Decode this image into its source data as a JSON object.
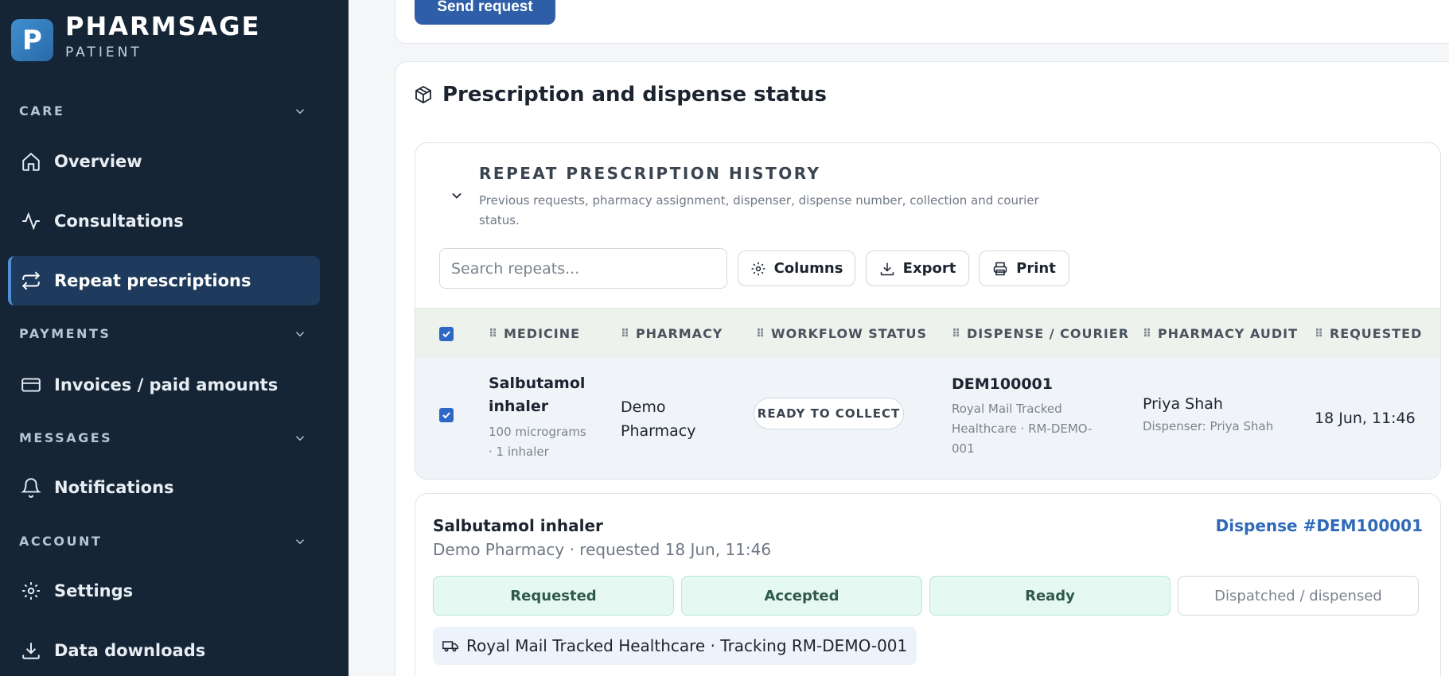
{
  "brand": {
    "logo_letter": "P",
    "name": "PHARMSAGE",
    "subtitle": "PATIENT"
  },
  "sidebar": {
    "sections": [
      {
        "label": "CARE"
      },
      {
        "label": "PAYMENTS"
      },
      {
        "label": "MESSAGES"
      },
      {
        "label": "ACCOUNT"
      }
    ],
    "items": [
      {
        "label": "Overview",
        "icon": "home-icon"
      },
      {
        "label": "Consultations",
        "icon": "activity-icon"
      },
      {
        "label": "Repeat prescriptions",
        "icon": "repeat-icon",
        "active": true
      },
      {
        "label": "Invoices / paid amounts",
        "icon": "credit-card-icon"
      },
      {
        "label": "Notifications",
        "icon": "bell-icon"
      },
      {
        "label": "Settings",
        "icon": "gear-icon"
      },
      {
        "label": "Data downloads",
        "icon": "download-icon"
      }
    ]
  },
  "top": {
    "send_label": "Send request"
  },
  "status": {
    "title": "Prescription and dispense status",
    "history": {
      "title": "REPEAT PRESCRIPTION HISTORY",
      "description": "Previous requests, pharmacy assignment, dispenser, dispense number, collection and courier status.",
      "search_placeholder": "Search repeats...",
      "columns_label": "Columns",
      "export_label": "Export",
      "print_label": "Print",
      "headers": [
        "MEDICINE",
        "PHARMACY",
        "WORKFLOW STATUS",
        "DISPENSE / COURIER",
        "PHARMACY AUDIT",
        "REQUESTED"
      ],
      "row": {
        "medicine": "Salbutamol inhaler",
        "medicine_detail": "100 micrograms · 1 inhaler",
        "pharmacy": "Demo Pharmacy",
        "workflow_status": "READY TO COLLECT",
        "dispense_number": "DEM100001",
        "courier": "Royal Mail Tracked Healthcare · RM-DEMO-001",
        "audit_name": "Priya Shah",
        "audit_detail": "Dispenser: Priya Shah",
        "requested": "18 Jun, 11:46"
      }
    },
    "dispense": {
      "title": "Salbutamol inhaler",
      "number": "Dispense #DEM100001",
      "subtitle": "Demo Pharmacy · requested 18 Jun, 11:46",
      "steps": [
        {
          "label": "Requested",
          "done": true
        },
        {
          "label": "Accepted",
          "done": true
        },
        {
          "label": "Ready",
          "done": true
        },
        {
          "label": "Dispatched / dispensed",
          "done": false
        }
      ],
      "courier": "Royal Mail Tracked Healthcare · Tracking RM-DEMO-001"
    }
  },
  "colors": {
    "sidebar_bg": "#152536",
    "accent": "#2f5ea8",
    "step_done": "#e6f8f2",
    "link": "#2f6ab8"
  }
}
